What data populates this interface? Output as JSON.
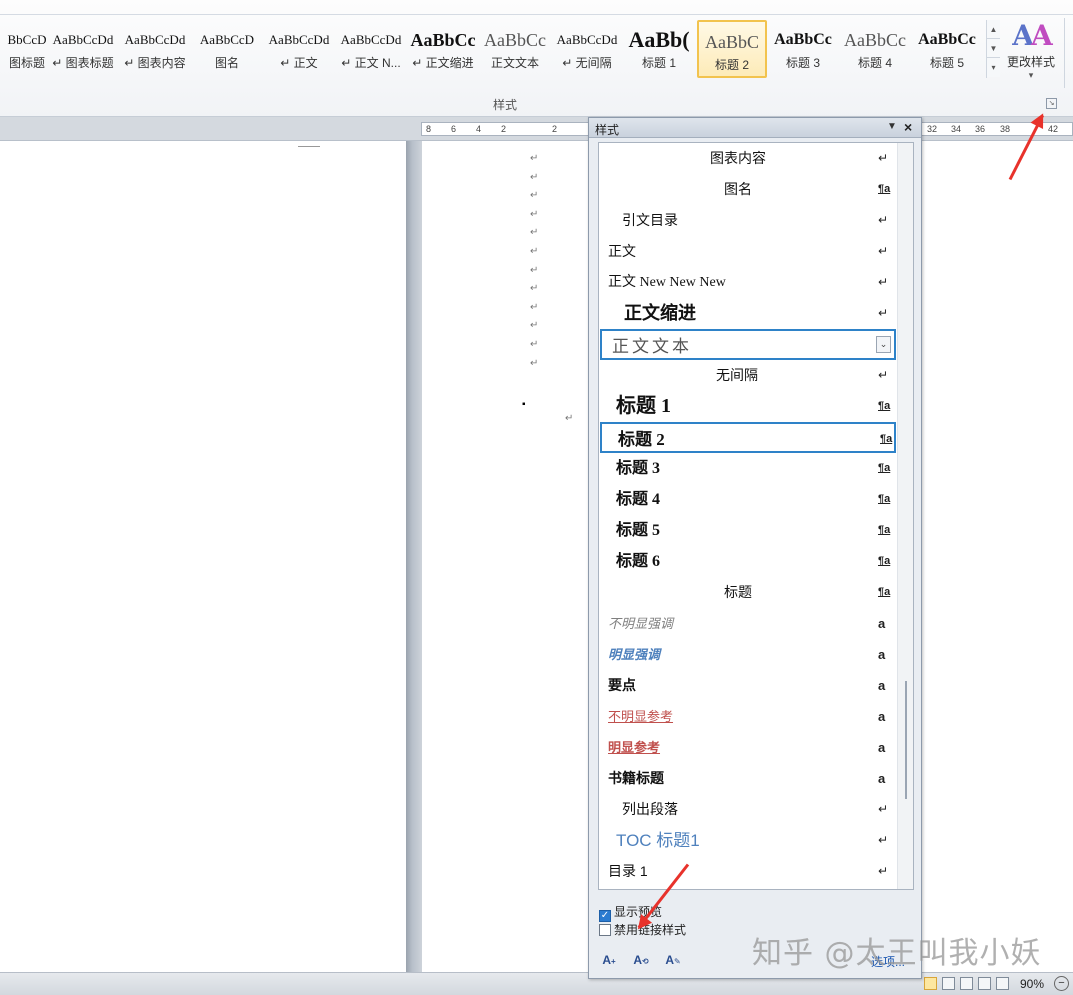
{
  "ribbon": {
    "gallery": [
      {
        "sample": "BbCcD",
        "label": "图标题"
      },
      {
        "sample": "AaBbCcDd",
        "label": "↵ 图表标题"
      },
      {
        "sample": "AaBbCcDd",
        "label": "↵ 图表内容"
      },
      {
        "sample": "AaBbCcD",
        "label": "图名"
      },
      {
        "sample": "AaBbCcDd",
        "label": "↵ 正文"
      },
      {
        "sample": "AaBbCcDd",
        "label": "↵ 正文 N..."
      },
      {
        "sample": "AaBbCc",
        "label": "↵ 正文缩进"
      },
      {
        "sample": "AaBbCc",
        "label": "正文文本"
      },
      {
        "sample": "AaBbCcDd",
        "label": "↵ 无间隔"
      },
      {
        "sample": "AaBb(",
        "label": "标题 1"
      },
      {
        "sample": "AaBbC",
        "label": "标题 2"
      },
      {
        "sample": "AaBbCc",
        "label": "标题 3"
      },
      {
        "sample": "AaBbCc",
        "label": "标题 4"
      },
      {
        "sample": "AaBbCc",
        "label": "标题 5"
      }
    ],
    "selected_index": 10,
    "change_styles_label": "更改样式",
    "group_label": "样式"
  },
  "ruler": {
    "left_ticks": [
      "8",
      "6",
      "4",
      "2",
      "2"
    ],
    "right_ticks": [
      "32",
      "34",
      "36",
      "38",
      "42"
    ]
  },
  "styles_pane": {
    "title": "样式",
    "items": [
      {
        "name": "图表内容",
        "mark": "↵",
        "mark_type": "para"
      },
      {
        "name": "图名",
        "mark": "¶a",
        "mark_type": "link"
      },
      {
        "name": "引文目录",
        "mark": "↵",
        "mark_type": "para"
      },
      {
        "name": "正文",
        "mark": "↵",
        "mark_type": "para"
      },
      {
        "name": "正文 New New New",
        "mark": "↵",
        "mark_type": "para"
      },
      {
        "name": "正文缩进",
        "mark": "↵",
        "mark_type": "para"
      },
      {
        "name": "正文文本",
        "mark": "",
        "mark_type": "none"
      },
      {
        "name": "无间隔",
        "mark": "↵",
        "mark_type": "para"
      },
      {
        "name": "标题 1",
        "mark": "¶a",
        "mark_type": "link"
      },
      {
        "name": "标题 2",
        "mark": "¶a",
        "mark_type": "link"
      },
      {
        "name": "标题 3",
        "mark": "¶a",
        "mark_type": "link"
      },
      {
        "name": "标题 4",
        "mark": "¶a",
        "mark_type": "link"
      },
      {
        "name": "标题 5",
        "mark": "¶a",
        "mark_type": "link"
      },
      {
        "name": "标题 6",
        "mark": "¶a",
        "mark_type": "link"
      },
      {
        "name": "标题",
        "mark": "¶a",
        "mark_type": "link"
      },
      {
        "name": "不明显强调",
        "mark": "a",
        "mark_type": "char"
      },
      {
        "name": "明显强调",
        "mark": "a",
        "mark_type": "char"
      },
      {
        "name": "要点",
        "mark": "a",
        "mark_type": "char"
      },
      {
        "name": "不明显参考",
        "mark": "a",
        "mark_type": "char"
      },
      {
        "name": "明显参考",
        "mark": "a",
        "mark_type": "char"
      },
      {
        "name": "书籍标题",
        "mark": "a",
        "mark_type": "char"
      },
      {
        "name": "列出段落",
        "mark": "↵",
        "mark_type": "para"
      },
      {
        "name": "TOC 标题1",
        "mark": "↵",
        "mark_type": "para"
      },
      {
        "name": "目录 1",
        "mark": "↵",
        "mark_type": "para"
      }
    ],
    "show_preview_label": "显示预览",
    "show_preview_checked": true,
    "disable_linked_label": "禁用链接样式",
    "disable_linked_checked": false,
    "options_label": "选项..."
  },
  "statusbar": {
    "zoom": "90%"
  },
  "watermark": "知乎 @太王叫我小妖",
  "colors": {
    "selection_border": "#2e82c8",
    "gallery_selected": "#f2c34e",
    "arrow": "#e8322b",
    "subtle_emphasis": "#7f7f7f",
    "intense_emphasis": "#4f81bd",
    "subtle_reference": "#c0504d",
    "toc_heading": "#4f81bd"
  }
}
